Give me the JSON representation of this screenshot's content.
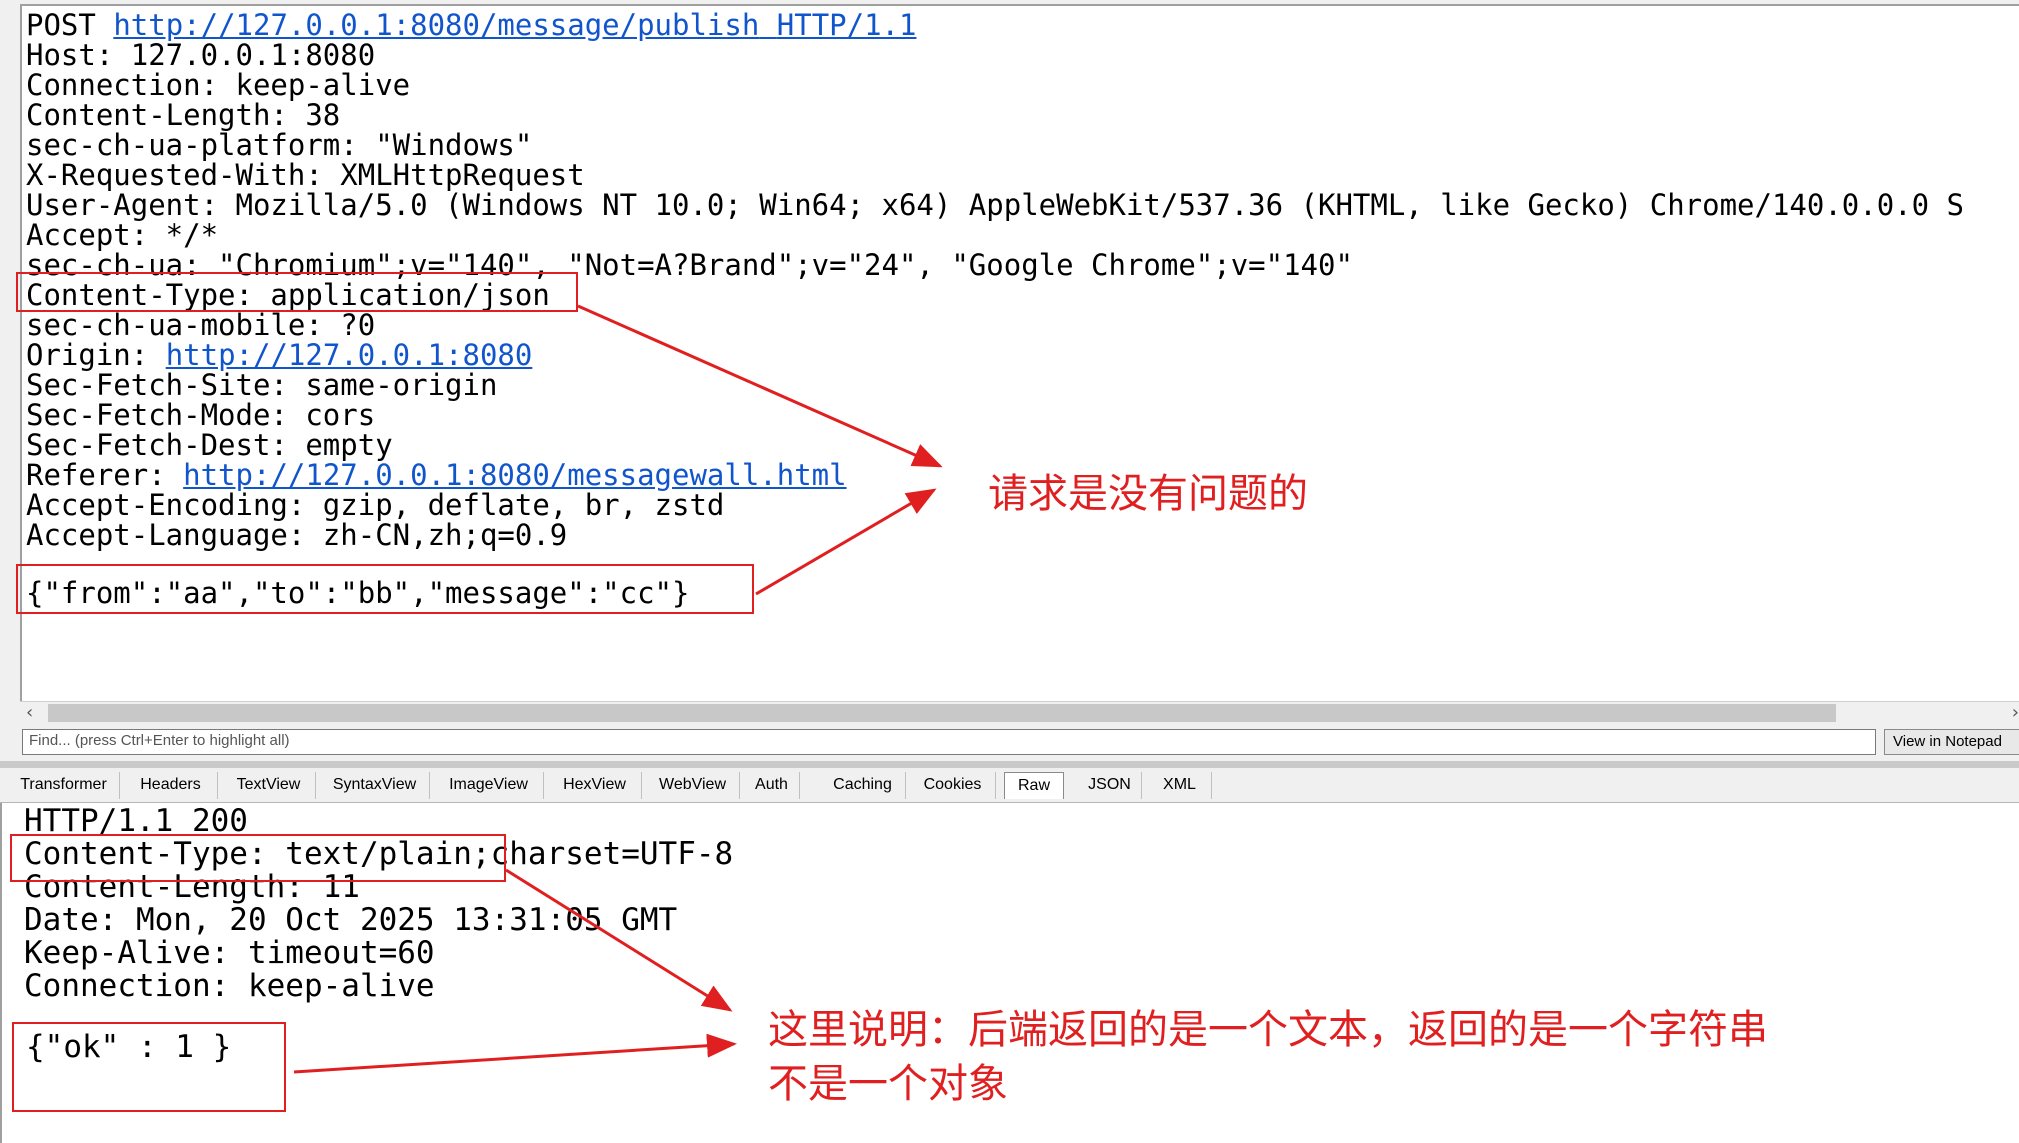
{
  "request": {
    "method": "POST",
    "url": "http://127.0.0.1:8080/message/publish",
    "protocol": "HTTP/1.1",
    "headers": [
      "Host: 127.0.0.1:8080",
      "Connection: keep-alive",
      "Content-Length: 38",
      "sec-ch-ua-platform: \"Windows\"",
      "X-Requested-With: XMLHttpRequest",
      "User-Agent: Mozilla/5.0 (Windows NT 10.0; Win64; x64) AppleWebKit/537.36 (KHTML, like Gecko) Chrome/140.0.0.0 S",
      "Accept: */*",
      "sec-ch-ua: \"Chromium\";v=\"140\", \"Not=A?Brand\";v=\"24\", \"Google Chrome\";v=\"140\"",
      "Content-Type: application/json",
      "sec-ch-ua-mobile: ?0"
    ],
    "origin_label": "Origin: ",
    "origin_url": "http://127.0.0.1:8080",
    "headers_after_origin": [
      "Sec-Fetch-Site: same-origin",
      "Sec-Fetch-Mode: cors",
      "Sec-Fetch-Dest: empty"
    ],
    "referer_label": "Referer: ",
    "referer_url": "http://127.0.0.1:8080/messagewall.html",
    "headers_after_referer": [
      "Accept-Encoding: gzip, deflate, br, zstd",
      "Accept-Language: zh-CN,zh;q=0.9"
    ],
    "body": "{\"from\":\"aa\",\"to\":\"bb\",\"message\":\"cc\"}"
  },
  "find": {
    "placeholder": "Find... (press Ctrl+Enter to highlight all)",
    "notepad_label": "View in Notepad"
  },
  "tabs": [
    {
      "label": "Transformer",
      "active": false
    },
    {
      "label": "Headers",
      "active": false
    },
    {
      "label": "TextView",
      "active": false
    },
    {
      "label": "SyntaxView",
      "active": false
    },
    {
      "label": "ImageView",
      "active": false
    },
    {
      "label": "HexView",
      "active": false
    },
    {
      "label": "WebView",
      "active": false
    },
    {
      "label": "Auth",
      "active": false
    },
    {
      "label": "Caching",
      "active": false
    },
    {
      "label": "Cookies",
      "active": false
    },
    {
      "label": "Raw",
      "active": true
    },
    {
      "label": "JSON",
      "active": false
    },
    {
      "label": "XML",
      "active": false
    }
  ],
  "response": {
    "lines": [
      "HTTP/1.1 200",
      "Content-Type: text/plain;charset=UTF-8",
      "Content-Length: 11",
      "Date: Mon, 20 Oct 2025 13:31:05 GMT",
      "Keep-Alive: timeout=60",
      "Connection: keep-alive"
    ],
    "body": "{\"ok\" : 1 }"
  },
  "annotations": {
    "request_note": "请求是没有问题的",
    "response_note_line1": "这里说明：后端返回的是一个文本，返回的是一个字符串",
    "response_note_line2": "不是一个对象"
  },
  "colors": {
    "annotation": "#e02020",
    "link": "#1155cc"
  }
}
